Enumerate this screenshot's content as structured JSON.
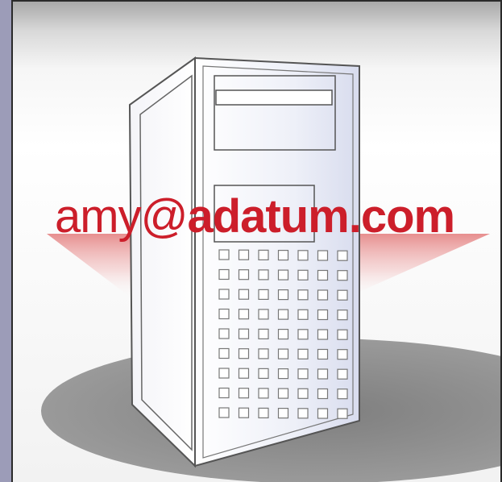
{
  "illustration": {
    "subject": "server-tower-icon",
    "email": {
      "user": "amy@",
      "domain": "adatum.com"
    },
    "colors": {
      "email_text": "#cc1e2a",
      "beam": "#e58a8a",
      "shadow": "#8a8a8a",
      "background_strip": "#9c9cb8"
    }
  }
}
